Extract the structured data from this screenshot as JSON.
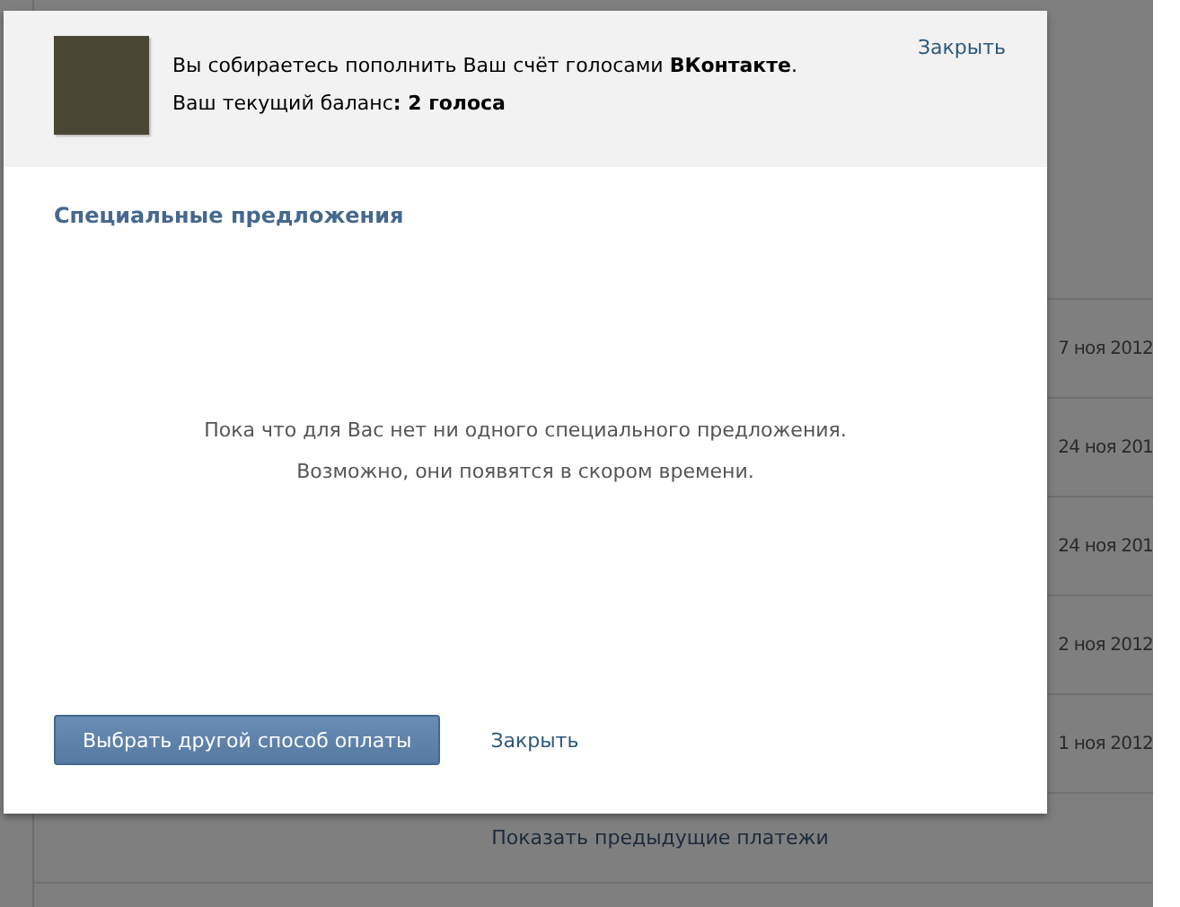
{
  "background_page": {
    "payments": [
      {
        "date": "7 ноя 2012"
      },
      {
        "date": "24 ноя 201"
      },
      {
        "date": "24 ноя 201"
      },
      {
        "date": "2 ноя 2012"
      },
      {
        "date": "1 ноя 2012"
      }
    ],
    "show_previous_link": "Показать предыдущие платежи"
  },
  "dialog": {
    "header": {
      "line_1": "Вы собираетесь пополнить Ваш счёт голосами **ВКонтакте**.",
      "line_2": "Ваш текущий баланс**: 2 голоса**",
      "close_link": "Закрыть"
    },
    "title": "Специальные предложения",
    "message_lines": [
      "Пока что для Вас нет ни одного специального предложения.",
      "Возможно, они появятся в скором времени."
    ],
    "buttons": [
      {
        "kind": "primary",
        "label": "Выбрать другой способ оплаты"
      },
      {
        "kind": "link",
        "label": "Закрыть"
      }
    ]
  }
}
